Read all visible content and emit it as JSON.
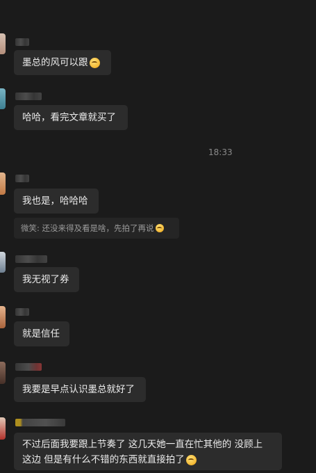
{
  "timestamp": "18:33",
  "messages": [
    {
      "text": "墨总的风可以跟",
      "emoji": "thinking-face-icon"
    },
    {
      "text": "哈哈，看完文章就买了"
    },
    {
      "text": "我也是，哈哈哈"
    },
    {
      "quote": "微笑: 还没来得及看是啥，先拍了再说",
      "quote_emoji": "sweat-face-icon"
    },
    {
      "text": "我无视了券"
    },
    {
      "text": "就是信任"
    },
    {
      "text": "我要是早点认识墨总就好了"
    },
    {
      "line1": "不过后面我要跟上节奏了 这几天她一直在忙其他的  没顾上",
      "line2": "这边 但是有什么不错的东西就直接拍了",
      "emoji": "sweat-face-icon"
    }
  ]
}
